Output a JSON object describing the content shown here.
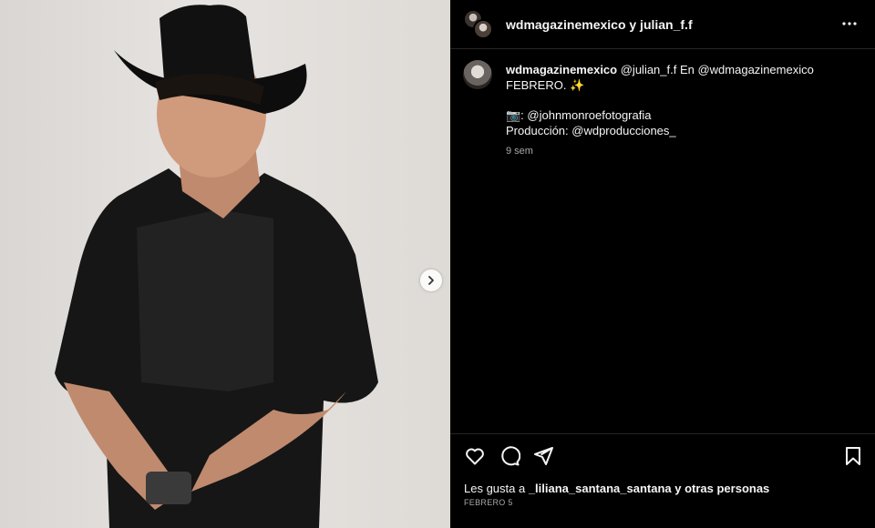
{
  "header": {
    "title": "wdmagazinemexico y julian_f.f"
  },
  "caption": {
    "username": "wdmagazinemexico",
    "line1": "@julian_f.f En @wdmagazinemexico",
    "line2": "FEBRERO. ✨",
    "line3": "📷: @johnmonroefotografia",
    "line4": "Producción: @wdproducciones_",
    "time": "9 sem"
  },
  "actions": {
    "likes_prefix": "Les gusta a ",
    "likes_users": "_liliana_santana_santana y otras personas",
    "date": "FEBRERO 5"
  },
  "icons": {
    "like": "heart-icon",
    "comment": "comment-icon",
    "share": "send-icon",
    "save": "bookmark-icon",
    "more": "more-icon",
    "next": "chevron-right-icon"
  }
}
